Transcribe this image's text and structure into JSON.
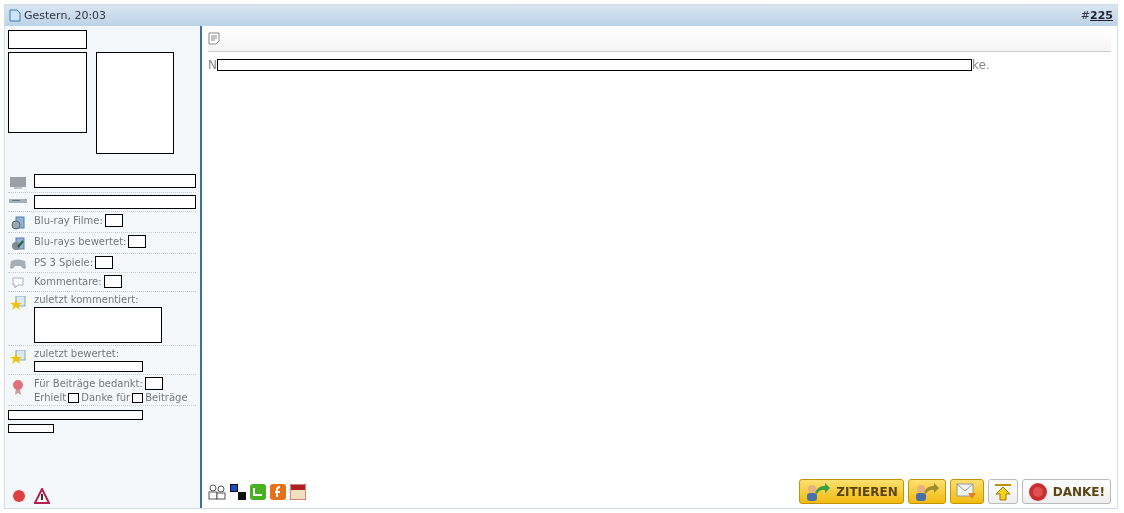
{
  "post_header": {
    "date": "Gestern, 20:03",
    "number_prefix": "#",
    "number": "225"
  },
  "sidebar": {
    "stats": [
      {
        "kind": "box_only"
      },
      {
        "kind": "box_only"
      },
      {
        "kind": "inline",
        "label": "Blu-ray Filme:"
      },
      {
        "kind": "inline",
        "label": "Blu-rays bewertet:"
      },
      {
        "kind": "inline",
        "label": "PS 3 Spiele:"
      },
      {
        "kind": "inline",
        "label": "Kommentare:"
      },
      {
        "kind": "block",
        "label": "zuletzt kommentiert:"
      },
      {
        "kind": "block",
        "label": "zuletzt bewertet:"
      },
      {
        "kind": "thanks",
        "label": "Für Beiträge bedankt:",
        "line2": [
          "Erhielt",
          "Danke für",
          "Beiträge"
        ]
      }
    ]
  },
  "message": {
    "start": "N",
    "end": "ke."
  },
  "buttons": [
    {
      "label": "ZITIEREN",
      "highlighted": true
    },
    {
      "highlighted": true
    },
    {
      "highlighted": true
    },
    {
      "highlighted": false
    },
    {
      "label": "DANKE!",
      "highlighted": false
    }
  ]
}
